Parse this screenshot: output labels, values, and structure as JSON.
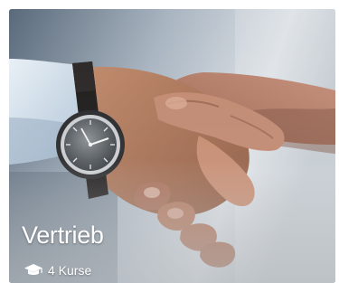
{
  "card": {
    "title": "Vertrieb",
    "course_count_label": "4 Kurse",
    "icon": "graduation-cap-icon",
    "image": "handshake-photo"
  },
  "colors": {
    "text": "#ffffff",
    "background": "#ffffff"
  }
}
